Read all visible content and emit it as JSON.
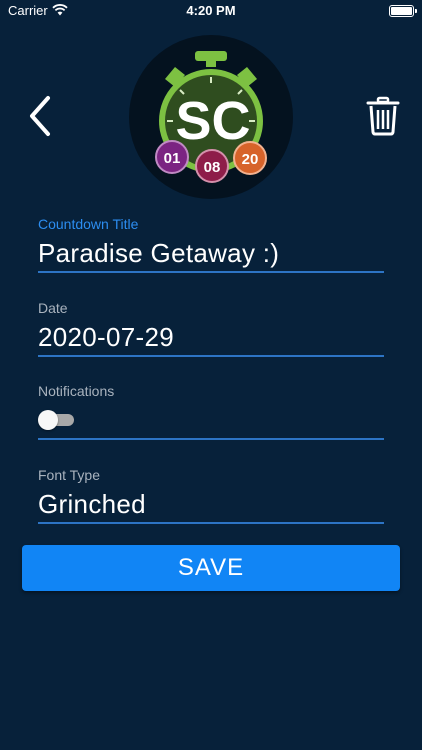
{
  "status_bar": {
    "carrier": "Carrier",
    "time": "4:20 PM"
  },
  "header": {
    "back_icon": "chevron-left-icon",
    "delete_icon": "trash-icon",
    "logo": {
      "monogram": "SC",
      "badges": [
        "01",
        "08",
        "20"
      ],
      "colors": {
        "ring": "#7dc142",
        "face": "#2f4d1f",
        "badge1": "#7b2482",
        "badge2": "#8e1d49",
        "badge3": "#d7632a"
      }
    }
  },
  "form": {
    "title": {
      "label": "Countdown Title",
      "value": "Paradise Getaway :)"
    },
    "date": {
      "label": "Date",
      "value": "2020-07-29"
    },
    "notifications": {
      "label": "Notifications",
      "enabled": false
    },
    "font_type": {
      "label": "Font Type",
      "value": "Grinched"
    }
  },
  "save_button": {
    "label": "SAVE"
  },
  "colors": {
    "background": "#07213a",
    "accent": "#1185f5",
    "active_label": "#2c8df0",
    "underline": "#2d74c4"
  }
}
